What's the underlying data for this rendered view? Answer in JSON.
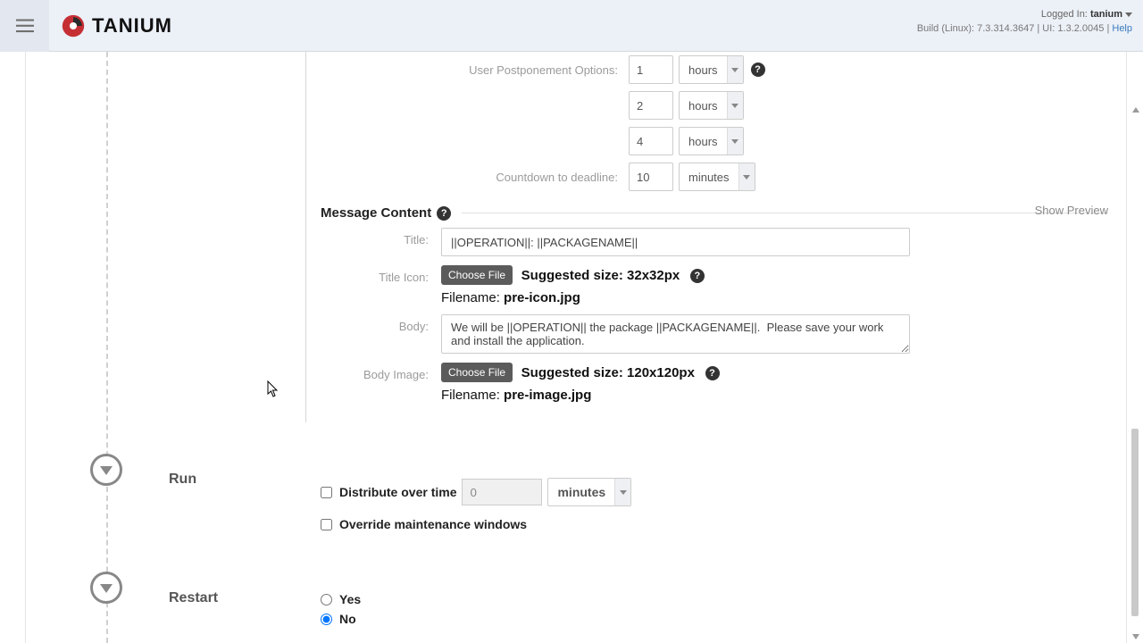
{
  "brand": {
    "name": "TANIUM"
  },
  "header": {
    "logged_in_label": "Logged In:",
    "user": "tanium",
    "build_line": "Build (Linux): 7.3.314.3647 | UI: 1.3.2.0045 | ",
    "help": "Help"
  },
  "postponement": {
    "label": "User Postponement Options:",
    "rows": [
      {
        "value": "1",
        "unit": "hours"
      },
      {
        "value": "2",
        "unit": "hours"
      },
      {
        "value": "4",
        "unit": "hours"
      }
    ],
    "countdown_label": "Countdown to deadline:",
    "countdown_value": "10",
    "countdown_unit": "minutes"
  },
  "message": {
    "section_title": "Message Content",
    "show_preview": "Show Preview",
    "title_label": "Title:",
    "title_value": "||OPERATION||: ||PACKAGENAME||",
    "title_icon_label": "Title Icon:",
    "choose_file": "Choose File",
    "title_icon_suggest": "Suggested size: 32x32px",
    "title_icon_filename_label": "Filename: ",
    "title_icon_filename": "pre-icon.jpg",
    "body_label": "Body:",
    "body_value": "We will be ||OPERATION|| the package ||PACKAGENAME||.  Please save your work and install the application.",
    "body_image_label": "Body Image:",
    "body_image_suggest": "Suggested size: 120x120px",
    "body_image_filename_label": "Filename: ",
    "body_image_filename": "pre-image.jpg"
  },
  "run": {
    "title": "Run",
    "distribute_label": "Distribute over time",
    "distribute_value": "0",
    "distribute_unit": "minutes",
    "override_label": "Override maintenance windows"
  },
  "restart": {
    "title": "Restart",
    "yes": "Yes",
    "no": "No"
  }
}
